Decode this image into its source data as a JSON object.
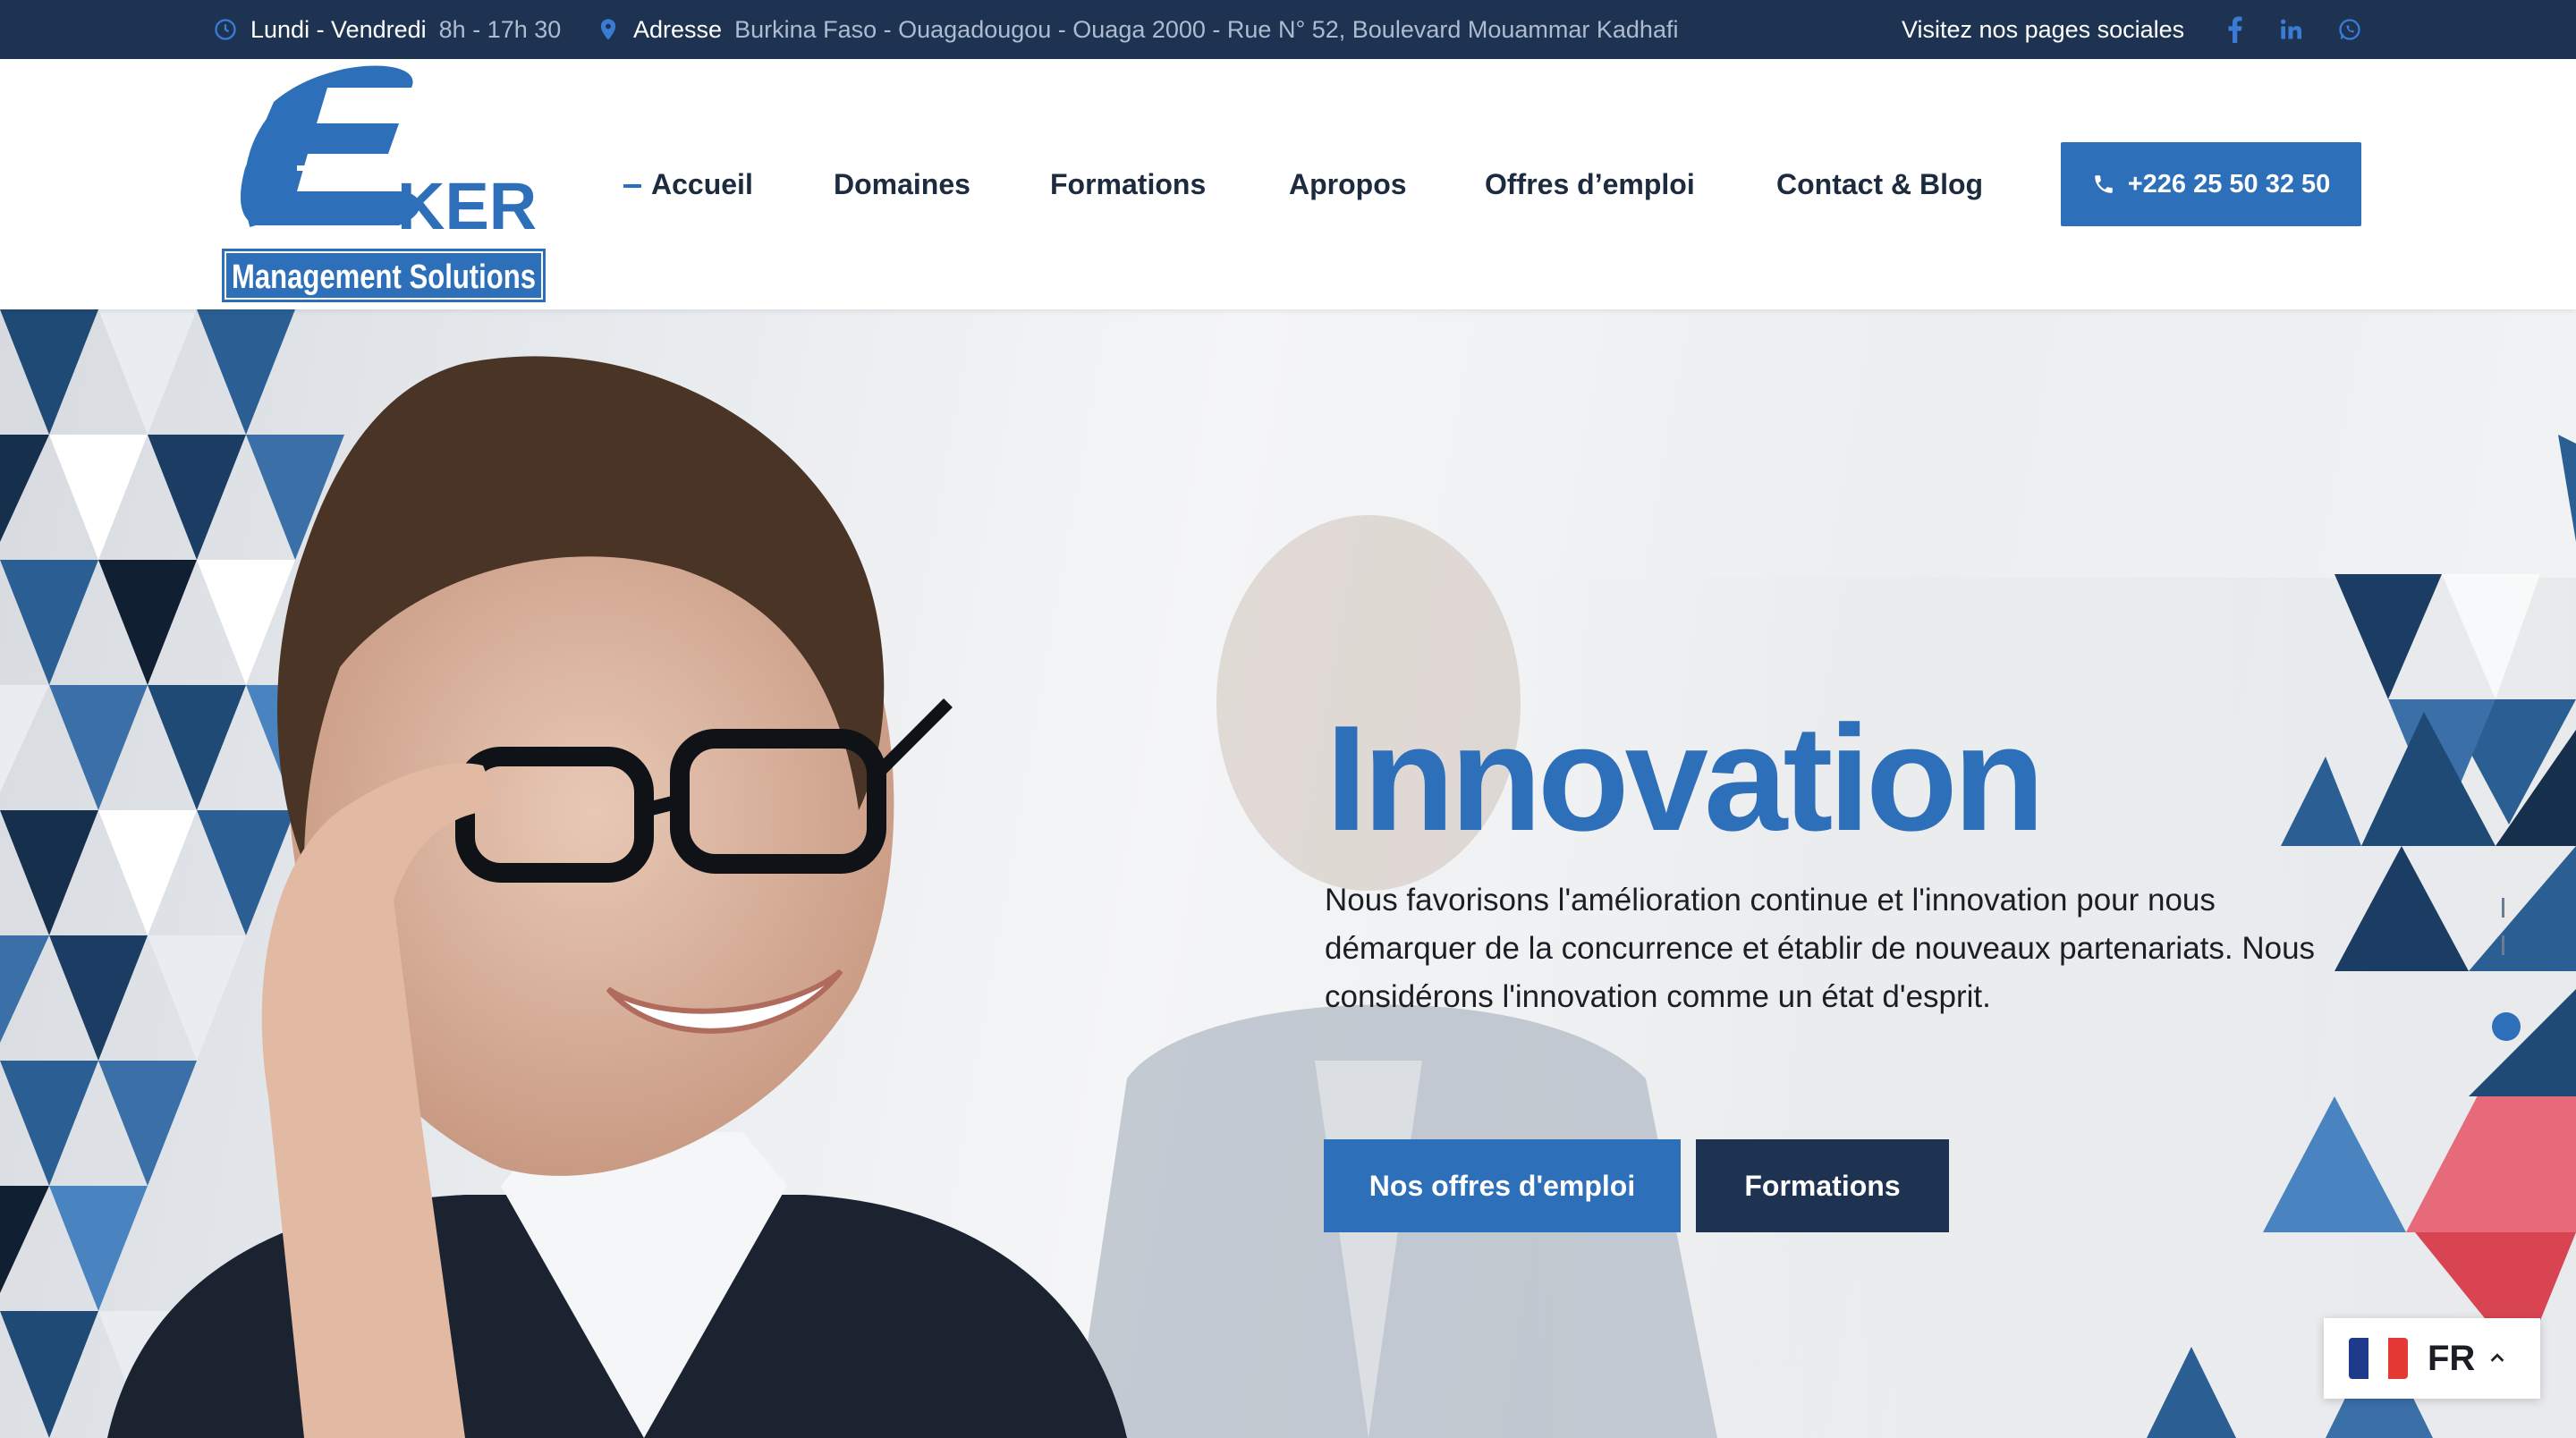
{
  "topbar": {
    "hours_label": "Lundi - Vendredi",
    "hours_value": "8h - 17h 30",
    "address_label": "Adresse",
    "address_value": "Burkina Faso - Ouagadougou - Ouaga 2000 - Rue N° 52, Boulevard Mouammar Kadhafi",
    "social_title": "Visitez nos pages sociales",
    "social_icons": [
      "facebook-icon",
      "linkedin-icon",
      "whatsapp-icon"
    ]
  },
  "logo": {
    "brand": "KER",
    "tagline": "Management Solutions"
  },
  "nav": {
    "items": [
      {
        "label": "Accueil",
        "active": true
      },
      {
        "label": "Domaines"
      },
      {
        "label": "Formations"
      },
      {
        "label": "Apropos"
      },
      {
        "label": "Offres d’emploi"
      },
      {
        "label": "Contact & Blog"
      }
    ],
    "phone": "+226 25 50 32 50"
  },
  "hero": {
    "title": "Innovation",
    "text": "Nous favorisons l'amélioration continue et l'innovation pour nous démarquer de la concurrence et établir de nouveaux partenariats. Nous considérons l'innovation comme un état d'esprit.",
    "btn_jobs": "Nos offres d'emploi",
    "btn_formations": "Formations"
  },
  "language": {
    "code": "FR"
  },
  "colors": {
    "accent": "#2e6fb9",
    "dark_navy": "#1d3351",
    "flag_blue": "#1e3a8a",
    "flag_red": "#e53935"
  }
}
